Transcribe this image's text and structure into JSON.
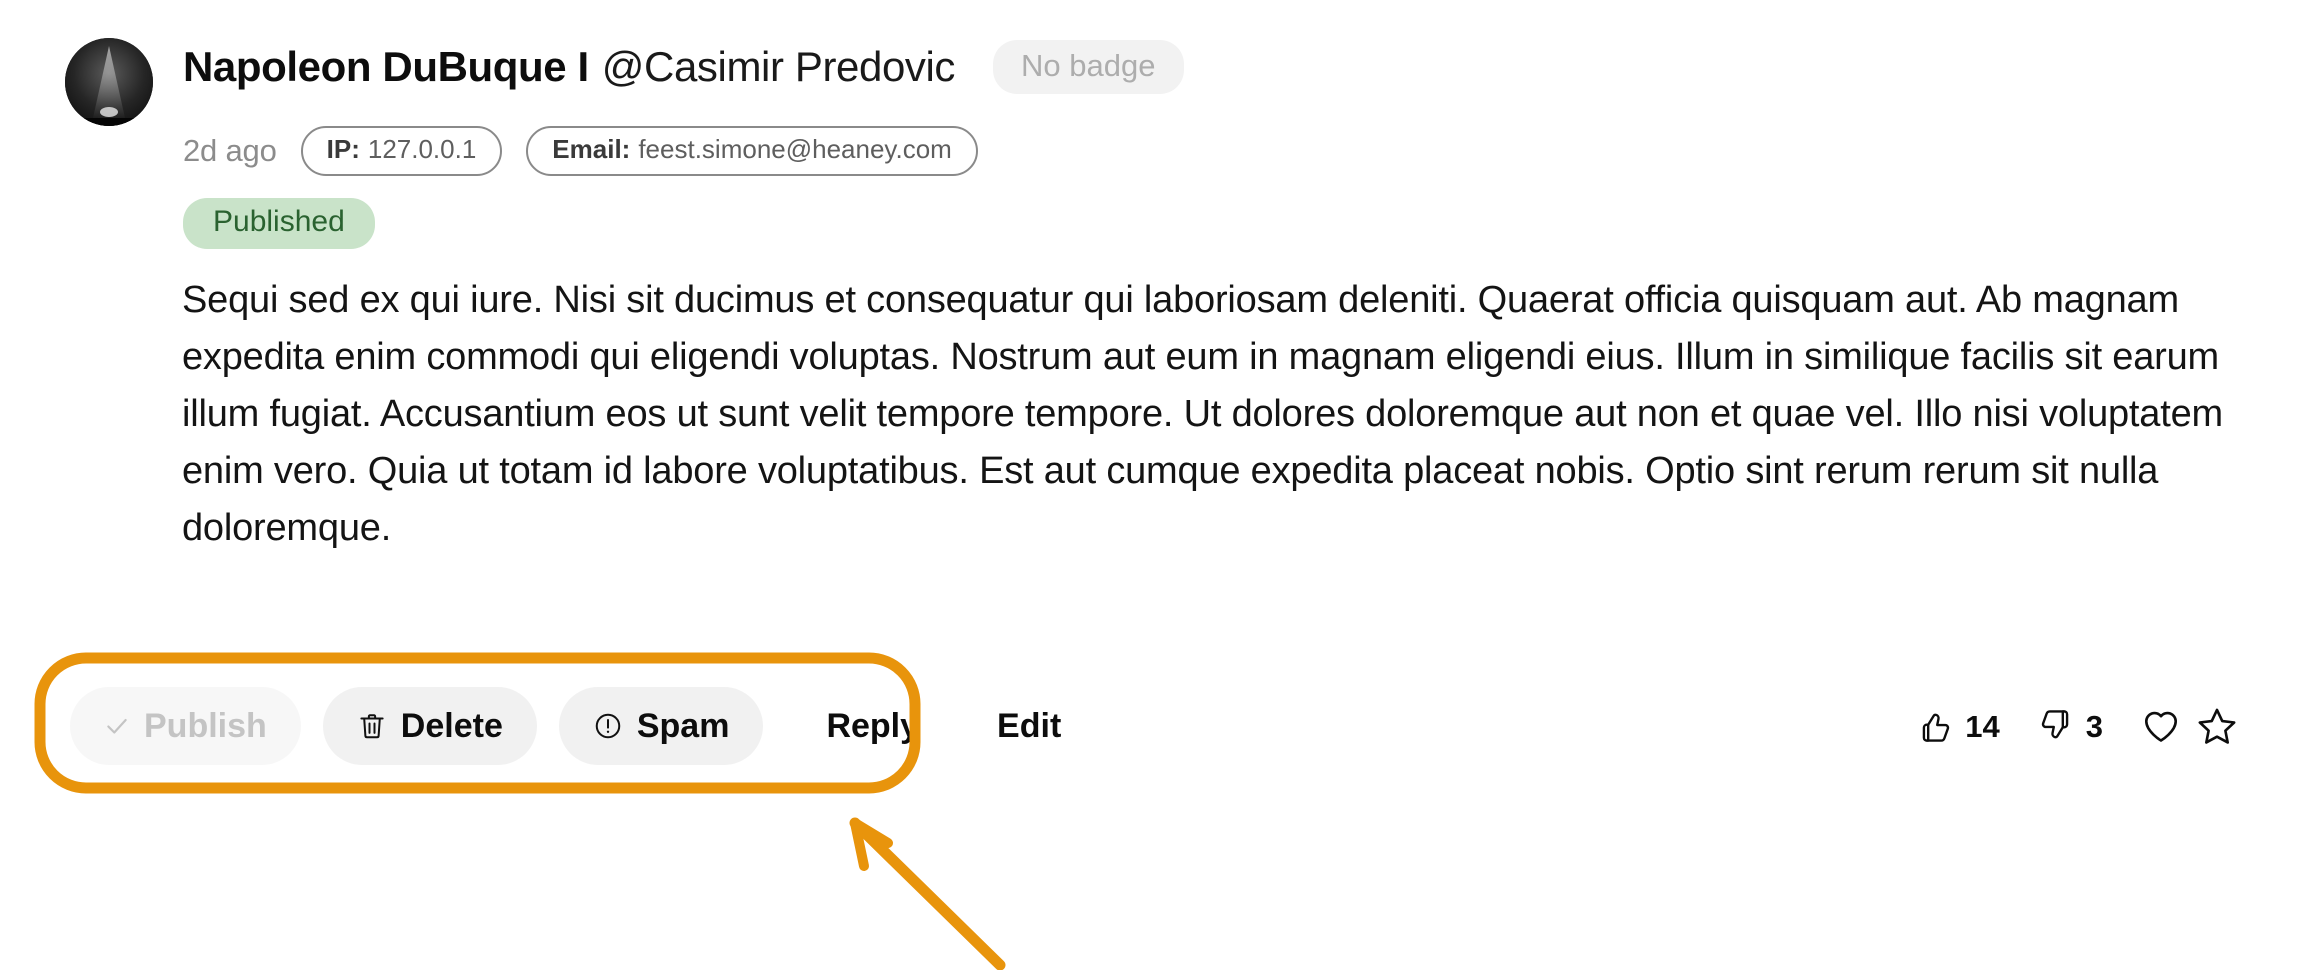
{
  "comment": {
    "author_name": "Napoleon DuBuque I",
    "author_handle": "@Casimir Predovic",
    "badge_label": "No badge",
    "timestamp": "2d ago",
    "ip_label": "IP:",
    "ip_value": "127.0.0.1",
    "email_label": "Email:",
    "email_value": "feest.simone@heaney.com",
    "status_label": "Published",
    "body": "Sequi sed ex qui iure. Nisi sit ducimus et consequatur qui laboriosam deleniti. Quaerat officia quisquam aut. Ab magnam expedita enim commodi qui eligendi voluptas. Nostrum aut eum in magnam eligendi eius. Illum in similique facilis sit earum illum fugiat. Accusantium eos ut sunt velit tempore tempore. Ut dolores doloremque aut non et quae vel. Illo nisi voluptatem enim vero. Quia ut totam id labore voluptatibus. Est aut cumque expedita placeat nobis. Optio sint rerum rerum sit nulla doloremque."
  },
  "actions": {
    "publish_label": "Publish",
    "publish_icon": "check-icon",
    "publish_disabled": true,
    "delete_label": "Delete",
    "delete_icon": "trash-icon",
    "spam_label": "Spam",
    "spam_icon": "exclamation-circle-icon",
    "reply_label": "Reply",
    "edit_label": "Edit"
  },
  "reactions": {
    "thumbs_up_icon": "thumbs-up-icon",
    "thumbs_up_count": "14",
    "thumbs_down_icon": "thumbs-down-icon",
    "thumbs_down_count": "3",
    "heart_icon": "heart-icon",
    "star_icon": "star-icon"
  },
  "annotation": {
    "highlight_color": "#E8940C",
    "target": "moderation-actions-group",
    "shape": "rounded-rect-with-arrow"
  },
  "colors": {
    "status_badge_bg": "#C9E3C9",
    "status_badge_text": "#2A6230",
    "pill_bg": "#F1F1F1",
    "pill_disabled_text": "#C4C4C4",
    "muted_text": "#8C8C8C",
    "annotation_orange": "#E8940C"
  }
}
